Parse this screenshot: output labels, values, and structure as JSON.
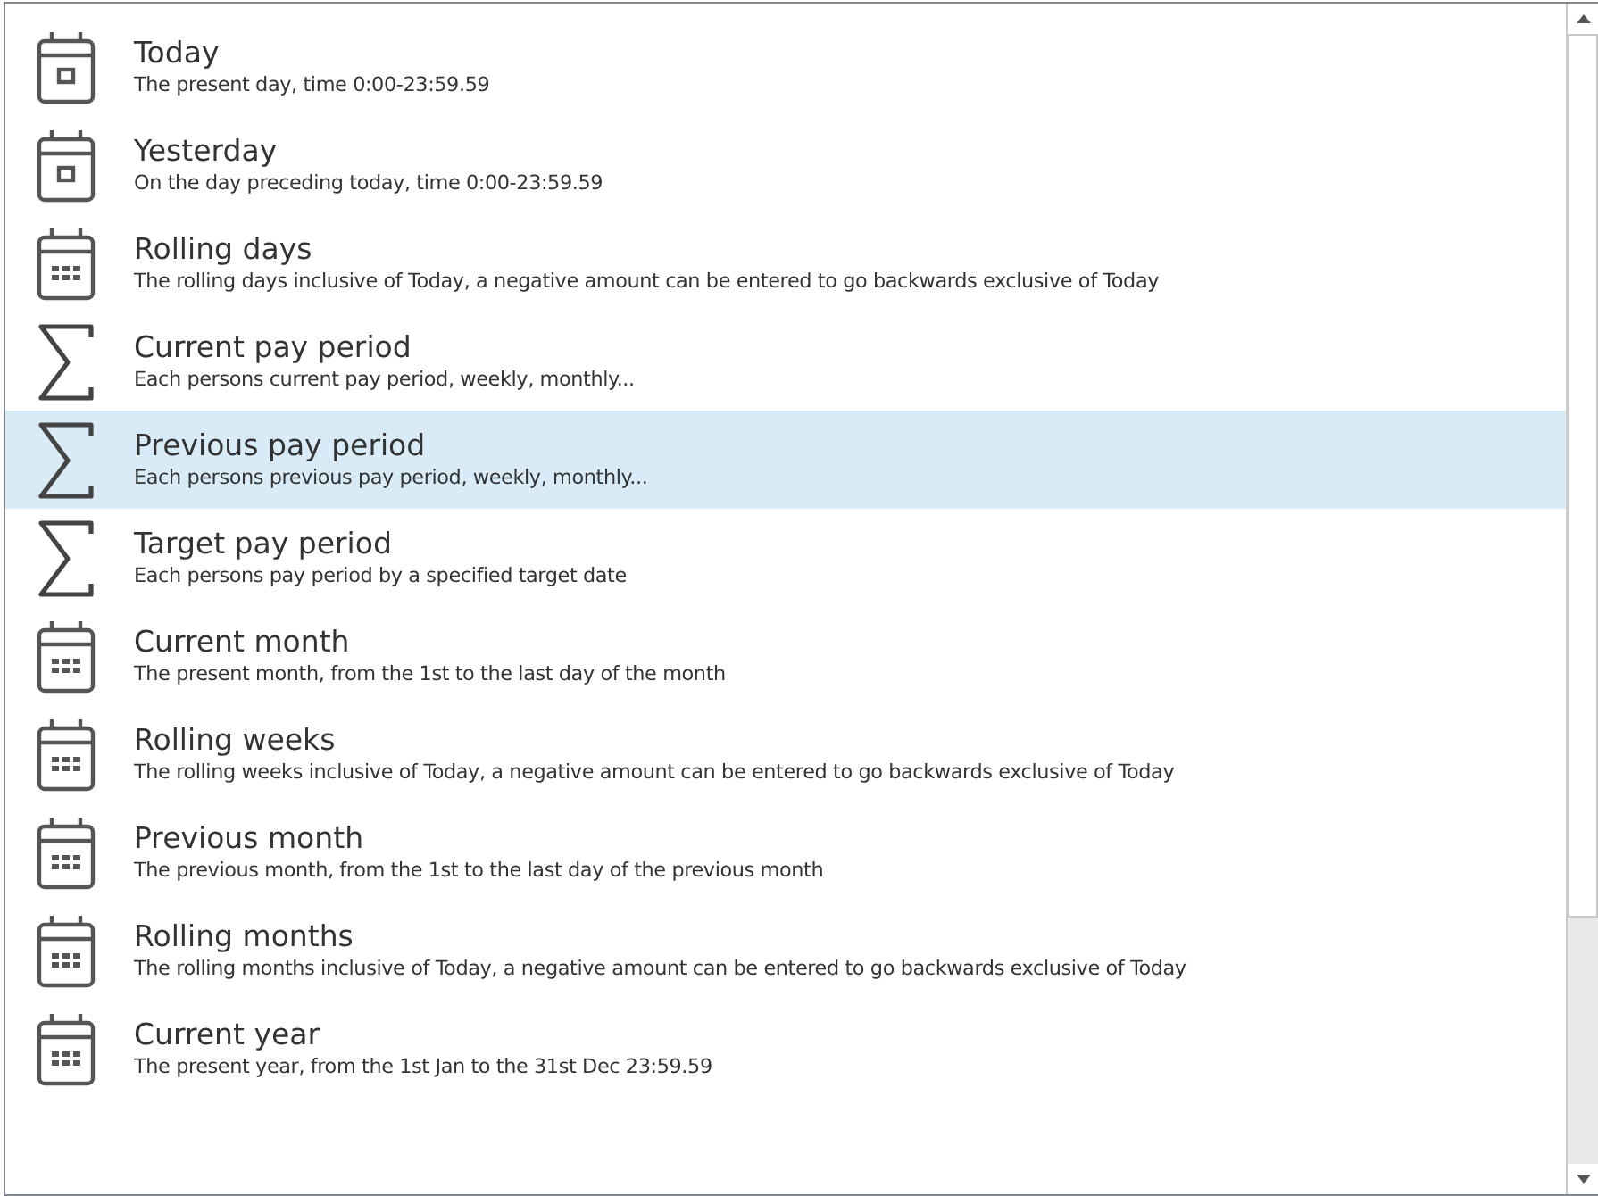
{
  "items": [
    {
      "kind": "day",
      "title": "Today",
      "description": "The present day, time 0:00-23:59.59",
      "selected": false
    },
    {
      "kind": "day",
      "title": "Yesterday",
      "description": "On the day preceding today, time 0:00-23:59.59",
      "selected": false
    },
    {
      "kind": "calendar",
      "title": "Rolling days",
      "description": "The rolling days inclusive of Today, a negative amount can be entered to go backwards exclusive of Today",
      "selected": false
    },
    {
      "kind": "sum",
      "title": "Current pay period",
      "description": "Each persons current pay period, weekly, monthly...",
      "selected": false
    },
    {
      "kind": "sum",
      "title": "Previous pay period",
      "description": "Each persons previous pay period, weekly, monthly...",
      "selected": true
    },
    {
      "kind": "sum",
      "title": "Target pay period",
      "description": "Each persons pay period by a specified target date",
      "selected": false
    },
    {
      "kind": "calendar",
      "title": "Current month",
      "description": "The present month, from the 1st to the last day of the month",
      "selected": false
    },
    {
      "kind": "calendar",
      "title": "Rolling weeks",
      "description": "The rolling weeks inclusive of Today, a negative amount can be entered to go backwards exclusive of Today",
      "selected": false
    },
    {
      "kind": "calendar",
      "title": "Previous month",
      "description": "The previous month, from the 1st to the last day of the previous month",
      "selected": false
    },
    {
      "kind": "calendar",
      "title": "Rolling months",
      "description": "The rolling months inclusive of Today, a negative amount can be entered to go backwards exclusive of Today",
      "selected": false
    },
    {
      "kind": "calendar",
      "title": "Current year",
      "description": "The present year, from the 1st Jan to the 31st Dec 23:59.59",
      "selected": false
    }
  ]
}
